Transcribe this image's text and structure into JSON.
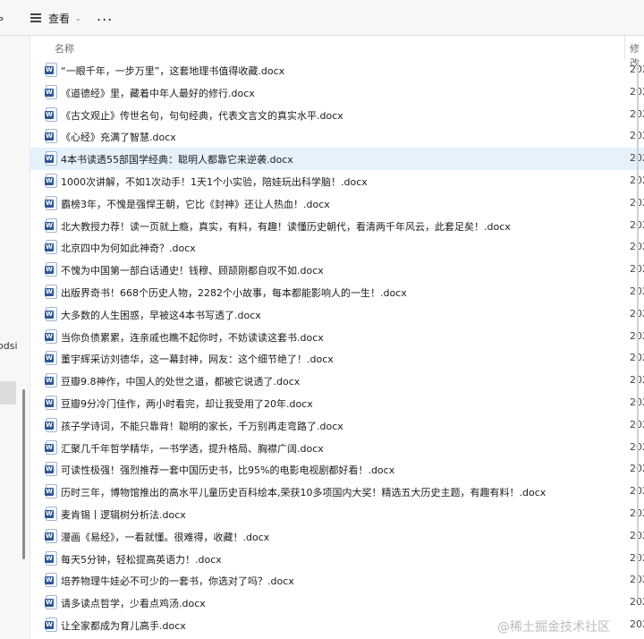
{
  "toolbar": {
    "clip_text": "ь",
    "view_label": "查看",
    "view_chevron": "⌄",
    "more_label": "..."
  },
  "nav": {
    "partial_label": "odsi"
  },
  "columns": {
    "name": "名称",
    "modified": "修改"
  },
  "files": [
    {
      "name": "“一眼千年，一步万里”，这套地理书值得收藏.docx",
      "date": "202"
    },
    {
      "name": "《道德经》里，藏着中年人最好的修行.docx",
      "date": "202"
    },
    {
      "name": "《古文观止》传世名句，句句经典，代表文言文的真实水平.docx",
      "date": "202"
    },
    {
      "name": "《心经》充满了智慧.docx",
      "date": "202"
    },
    {
      "name": "4本书读透55部国学经典：聪明人都靠它来逆袭.docx",
      "date": "202",
      "selected": true
    },
    {
      "name": "1000次讲解，不如1次动手！1天1个小实验，陪娃玩出科学脑！.docx",
      "date": "202"
    },
    {
      "name": "霸榜3年，不愧是强悍王朝，它比《封神》还让人热血！.docx",
      "date": "202"
    },
    {
      "name": "北大教授力荐！读一页就上瘾，真实，有料，有趣！读懂历史朝代，看清两千年风云，此套足矣！.docx",
      "date": "202"
    },
    {
      "name": "北京四中为何如此神奇？.docx",
      "date": "202"
    },
    {
      "name": "不愧为中国第一部白话通史！钱穆、顾颉刚都自叹不如.docx",
      "date": "202"
    },
    {
      "name": "出版界奇书！668个历史人物，2282个小故事，每本都能影响人的一生！.docx",
      "date": "202"
    },
    {
      "name": "大多数的人生困惑，早被这4本书写透了.docx",
      "date": "202"
    },
    {
      "name": "当你负债累累，连亲戚也瞧不起你时，不妨读读这套书.docx",
      "date": "202"
    },
    {
      "name": "董宇辉采访刘德华，这一幕封神，网友：这个细节绝了！.docx",
      "date": "202"
    },
    {
      "name": "豆瓣9.8神作，中国人的处世之道，都被它说透了.docx",
      "date": "202"
    },
    {
      "name": "豆瓣9分冷门佳作，两小时看完，却让我受用了20年.docx",
      "date": "202"
    },
    {
      "name": "孩子学诗词，不能只靠背！聪明的家长，千万别再走弯路了.docx",
      "date": "202"
    },
    {
      "name": "汇聚几千年哲学精华，一书学透，提升格局、胸襟广阔.docx",
      "date": "202"
    },
    {
      "name": "可读性极强！强烈推荐一套中国历史书，比95%的电影电视剧都好看！.docx",
      "date": "202"
    },
    {
      "name": "历时三年，博物馆推出的高水平儿童历史百科绘本,荣获10多项国内大奖！精选五大历史主题，有趣有料！.docx",
      "date": "202"
    },
    {
      "name": "麦肯锡丨逻辑树分析法.docx",
      "date": "202"
    },
    {
      "name": "漫画《易经》，一看就懂。很难得，收藏！.docx",
      "date": "202"
    },
    {
      "name": "每天5分钟，轻松提高英语力！.docx",
      "date": "202"
    },
    {
      "name": "培养物理牛娃必不可少的一套书，你选对了吗？.docx",
      "date": "202"
    },
    {
      "name": "请多读点哲学，少看点鸡汤.docx",
      "date": "202"
    },
    {
      "name": "让全家都成为育儿高手.docx",
      "date": "202"
    }
  ],
  "watermark": "@稀土掘金技术社区"
}
